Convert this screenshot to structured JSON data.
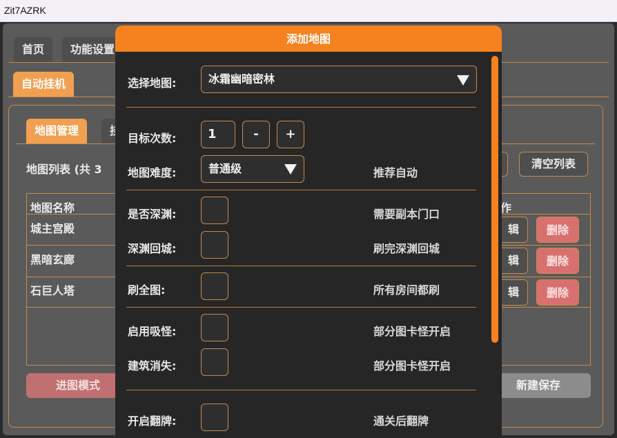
{
  "window": {
    "title": "Zit7AZRK"
  },
  "main_tabs": [
    {
      "label": "首页"
    },
    {
      "label": "功能设置"
    }
  ],
  "sub_tabs": [
    {
      "label": "自动挂机"
    }
  ],
  "inner_tabs": [
    {
      "label": "地图管理"
    },
    {
      "label": "挂"
    }
  ],
  "map_list": {
    "summary": "地图列表 (共 3",
    "clear_label": "清空列表",
    "columns": [
      "地图名称",
      "作"
    ],
    "rows": [
      {
        "name": "城主宫殿",
        "edit_label": "辑",
        "delete_label": "删除"
      },
      {
        "name": "黑暗玄廊",
        "edit_label": "辑",
        "delete_label": "删除"
      },
      {
        "name": "石巨人塔",
        "edit_label": "辑",
        "delete_label": "删除"
      }
    ]
  },
  "bottom": {
    "enter_mode_label": "进图模式",
    "new_save_label": "新建保存"
  },
  "dialog": {
    "title": "添加地图",
    "select_map": {
      "label": "选择地图:",
      "value": "冰霜幽暗密林"
    },
    "target_count": {
      "label": "目标次数:",
      "value": "1",
      "minus": "-",
      "plus": "+"
    },
    "difficulty": {
      "label": "地图难度:",
      "value": "普通级",
      "hint": "推荐自动"
    },
    "abyss": {
      "label": "是否深渊:",
      "hint": "需要副本门口"
    },
    "abyss_return": {
      "label": "深渊回城:",
      "hint": "刷完深渊回城"
    },
    "full_map": {
      "label": "刷全图:",
      "hint": "所有房间都刷"
    },
    "absorb": {
      "label": "启用吸怪:",
      "hint": "部分图卡怪开启"
    },
    "building_vanish": {
      "label": "建筑消失:",
      "hint": "部分图卡怪开启"
    },
    "flip_card": {
      "label": "开启翻牌:",
      "hint": "通关后翻牌"
    }
  }
}
